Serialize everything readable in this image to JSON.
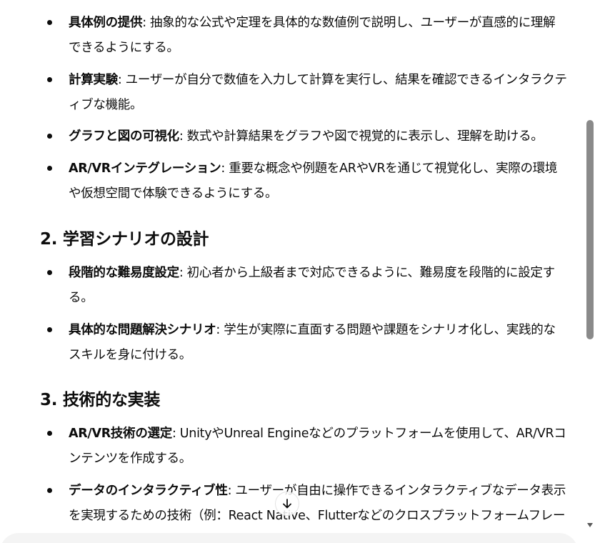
{
  "list1": [
    {
      "bold": "具体例の提供",
      "text": ": 抽象的な公式や定理を具体的な数値例で説明し、ユーザーが直感的に理解できるようにする。"
    },
    {
      "bold": "計算実験",
      "text": ": ユーザーが自分で数値を入力して計算を実行し、結果を確認できるインタラクティブな機能。"
    },
    {
      "bold": "グラフと図の可視化",
      "text": ": 数式や計算結果をグラフや図で視覚的に表示し、理解を助ける。"
    },
    {
      "bold": "AR/VRインテグレーション",
      "text": ": 重要な概念や例題をARやVRを通じて視覚化し、実際の環境や仮想空間で体験できるようにする。"
    }
  ],
  "section2": {
    "heading": "2. 学習シナリオの設計"
  },
  "list2": [
    {
      "bold": "段階的な難易度設定",
      "text": ": 初心者から上級者まで対応できるように、難易度を段階的に設定する。"
    },
    {
      "bold": "具体的な問題解決シナリオ",
      "text": ": 学生が実際に直面する問題や課題をシナリオ化し、実践的なスキルを身に付ける。"
    }
  ],
  "section3": {
    "heading": "3. 技術的な実装"
  },
  "list3": [
    {
      "bold": "AR/VR技術の選定",
      "text": ": UnityやUnreal Engineなどのプラットフォームを使用して、AR/VRコンテンツを作成する。"
    },
    {
      "bold": "データのインタラクティブ性",
      "text": ": ユーザーが自由に操作できるインタラクティブなデータ表示を実現するための技術（例：React Native、Flutterなどのクロスプラットフォームフレームワーク）。"
    }
  ],
  "icons": {
    "scroll_down": "arrow-down-icon"
  }
}
